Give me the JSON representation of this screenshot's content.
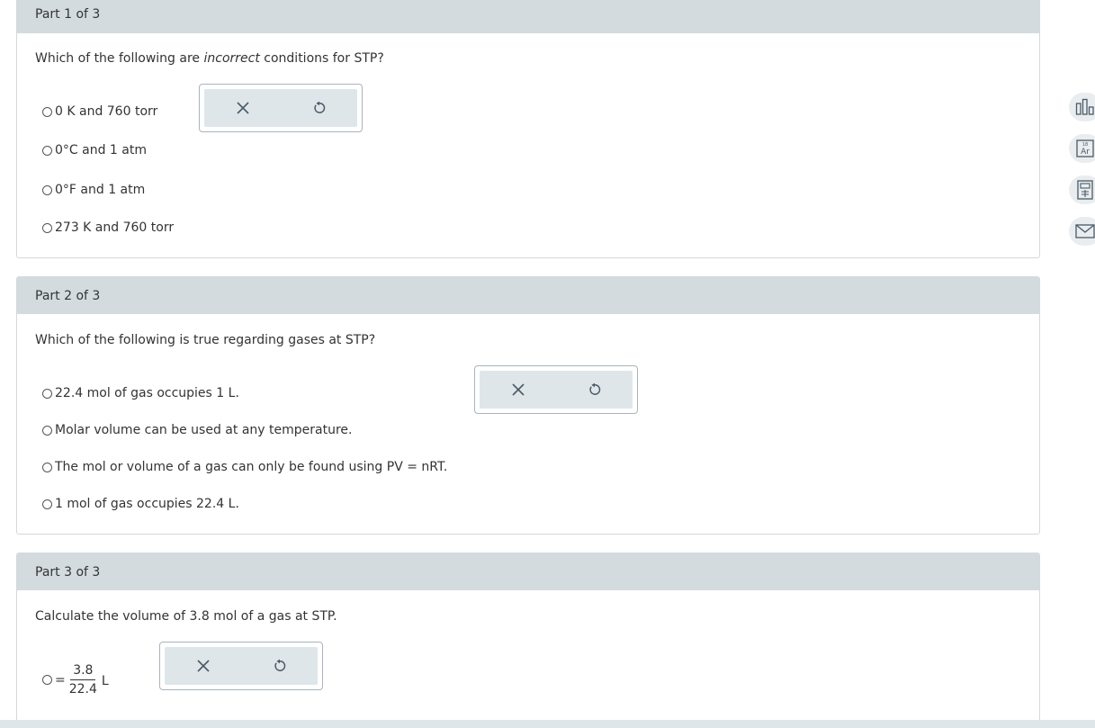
{
  "part1": {
    "header": "Part 1 of 3",
    "question_prefix": "Which of the following are ",
    "question_emphasis": "incorrect",
    "question_suffix": " conditions for STP?",
    "options": [
      "0 K and 760 torr",
      "0°C and 1 atm",
      "0°F and 1 atm",
      "273 K and 760 torr"
    ]
  },
  "part2": {
    "header": "Part 2 of 3",
    "question": "Which of the following is true regarding gases at STP?",
    "options": [
      "22.4 mol of gas occupies 1 L.",
      "Molar volume can be used at any temperature.",
      "The mol or volume of a gas can only be found using PV = nRT.",
      "1 mol of gas occupies 22.4 L."
    ]
  },
  "part3": {
    "header": "Part 3 of 3",
    "question": "Calculate the volume of 3.8 mol of a gas at STP.",
    "answer": {
      "equals": "=",
      "numerator": "3.8",
      "denominator": "22.4",
      "unit": "L"
    }
  },
  "toolbox": {
    "clear_icon": "close-icon",
    "undo_icon": "undo-icon"
  },
  "side_tools": [
    "chart-icon",
    "periodic-table-icon",
    "calculator-icon",
    "mail-icon"
  ],
  "colors": {
    "header_bg": "#d4dbdf",
    "tool_bg": "#dfe6ea",
    "icon": "#4a5a66"
  }
}
